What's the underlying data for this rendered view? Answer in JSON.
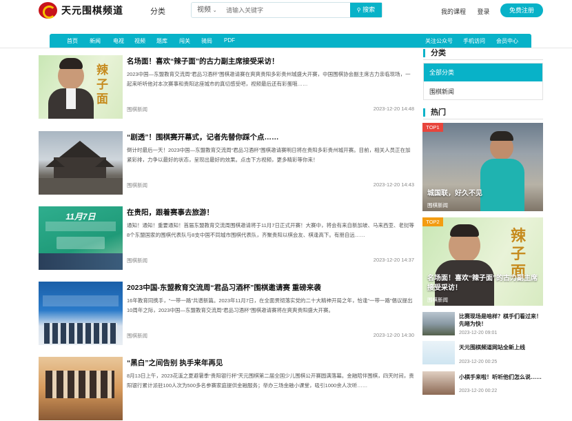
{
  "header": {
    "site_name": "天元围棋频道",
    "category_label": "分类",
    "search_type": "视频",
    "search_placeholder": "请输入关键字",
    "search_button": "搜索",
    "my_courses": "我的课程",
    "login": "登录",
    "register": "免费注册"
  },
  "nav": {
    "items": [
      "首页",
      "新闻",
      "电视",
      "视频",
      "题库",
      "闯关",
      "骑局",
      "PDF"
    ],
    "right_items": [
      "关注公众号",
      "手机访问",
      "会员中心"
    ]
  },
  "articles": [
    {
      "title": "名场面！喜欢“辣子面”的古力副主席接受采访！",
      "desc": "2023中国—东盟教育交流周“君品习酒杯”围棋邀请赛在爽爽贵阳多彩贵州城盛大开赛，中国围棋协会副主席古力亲临现场，一起来听听他对本次赛事和贵阳这座城市的真切感受吧，视频最后还有彩蛋哦……",
      "tag": "围棋新闻",
      "date": "2023-12-20 14:48",
      "thumb_text": "辣子面"
    },
    {
      "title": "“剧透”！围棋赛开幕式，记者先替你踩个点……",
      "desc": "倒计时最后一天！2023中国—东盟教育交流周“君品习酒杯”围棋邀请赛明日将在贵阳多彩贵州城开赛。目前，相关人员正在加紧彩排，力争以最好的状态，呈现出最好的效果。点击下方视频，更多精彩等你来！",
      "tag": "围棋新闻",
      "date": "2023-12-20 14:43",
      "thumb_text": ""
    },
    {
      "title": "在贵阳，跟着赛事去旅游！",
      "desc": "通知！通知！重要通知！首届东盟教育交流周围棋邀请将于11月7日正式开赛！大赛中，将会有来自新加坡、马来西亚、老挝等8个东盟国家的围棋代表队与8支中国不同城市围棋代表队，齐聚贵阳以棋会友、棋逢高下。有朋自远……",
      "tag": "围棋新闻",
      "date": "2023-12-20 14:37",
      "thumb_text": "11月7日"
    },
    {
      "title": "2023中国-东盟教育交流周“君品习酒杯”围棋邀请赛 重磅来袭",
      "desc": "16年教育同携手，“一带一路”共谱新篇。2023年11月7日，在全面贯彻落实党的二十大精神开局之年，恰逢“一带一路”倡议提出10周年之际，2023中国—东盟教育交流周“君品习酒杯”围棋邀请赛将在爽爽贵阳盛大开赛。",
      "tag": "围棋新闻",
      "date": "2023-12-20 14:30",
      "thumb_text": ""
    },
    {
      "title": "“黑白”之间告别 执手来年再见",
      "desc": "8月13日上午，2023花溪之夏避暑季“贵阳银行杯”天元围棋第二届全国少儿围棋公开赛圆满落幕。金融陪伴围棋，四天时间，贵阳银行累计派驻100人次为500多名参赛家庭提供金融服务；举办三场金融小课堂，吸引1000余人次听……",
      "tag": "",
      "date": "",
      "thumb_text": ""
    }
  ],
  "sidebar": {
    "category_heading": "分类",
    "categories": [
      "全部分类",
      "围棋新闻"
    ],
    "hot_heading": "热门",
    "hot": [
      {
        "badge": "TOP1",
        "caption": "城国联，好久不见",
        "tag": "围棋新闻"
      },
      {
        "badge": "TOP2",
        "caption": "名场面！喜欢“辣子面”的古力副主席接受采访！",
        "tag": "围棋新闻"
      }
    ],
    "small": [
      {
        "title": "比赛现场是啥样？棋手们看过来！先睹为快！",
        "date": "2023-12-20 09:01"
      },
      {
        "title": "天元围棋频道网站全新上线",
        "date": "2023-12-20 00:25"
      },
      {
        "title": "小棋手来啦！听听他们怎么说……",
        "date": "2023-12-20 00:22"
      }
    ],
    "colors": {
      "accent": "#08b2c8",
      "top1": "#e8453c",
      "top2": "#f39c12"
    }
  }
}
